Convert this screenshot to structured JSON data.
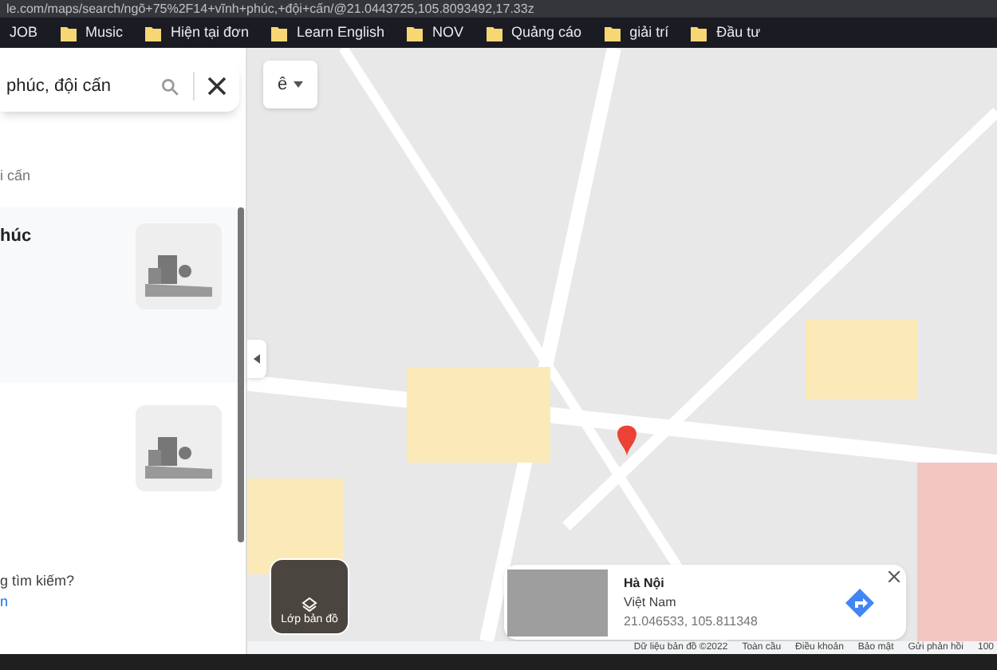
{
  "address_bar": {
    "url": "le.com/maps/search/ngõ+75%2F14+vĩnh+phúc,+đội+cấn/@21.0443725,105.8093492,17.33z"
  },
  "bookmarks": [
    {
      "label": "JOB",
      "folder": false
    },
    {
      "label": "Music",
      "folder": true
    },
    {
      "label": "Hiện tại đơn",
      "folder": true
    },
    {
      "label": "Learn English",
      "folder": true
    },
    {
      "label": "NOV",
      "folder": true
    },
    {
      "label": "Quảng cáo",
      "folder": true
    },
    {
      "label": "giải trí",
      "folder": true
    },
    {
      "label": "Đầu tư",
      "folder": true
    }
  ],
  "search": {
    "value": "phúc, đội cấn"
  },
  "sidebar": {
    "subtitle": "i cấn",
    "results": [
      {
        "title": "húc"
      }
    ],
    "question": "g tìm kiếm?",
    "link": "n"
  },
  "map": {
    "lang_button": "ê",
    "layers_label": "Lớp bản đồ"
  },
  "place_card": {
    "title": "Hà Nội",
    "country": "Việt Nam",
    "coords": "21.046533, 105.811348"
  },
  "attribution": [
    "Dữ liệu bản đồ ©2022",
    "Toàn cầu",
    "Điều khoản",
    "Bảo mật",
    "Gửi phản hồi",
    "100"
  ]
}
